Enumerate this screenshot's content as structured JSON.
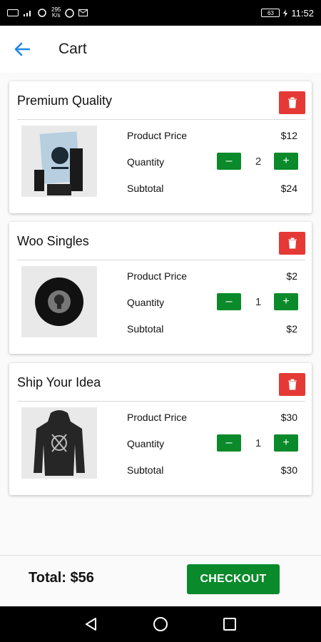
{
  "status_bar": {
    "speed_top": "295",
    "speed_bottom": "K/s",
    "battery": "63",
    "time": "11:52",
    "icons": [
      "volte-icon",
      "signal-icon",
      "wifi-icon",
      "whatsapp-icon",
      "gmail-icon",
      "vibrate-icon",
      "charging-icon"
    ]
  },
  "app_bar": {
    "title": "Cart",
    "back_icon": "arrow-left-icon"
  },
  "labels": {
    "price": "Product Price",
    "quantity": "Quantity",
    "subtotal": "Subtotal",
    "minus": "–",
    "plus": "+"
  },
  "cart_items": [
    {
      "name": "Premium Quality",
      "price": "$12",
      "quantity": "2",
      "subtotal": "$24",
      "image": "poster-photo"
    },
    {
      "name": "Woo Singles",
      "price": "$2",
      "quantity": "1",
      "subtotal": "$2",
      "image": "vinyl-record-photo"
    },
    {
      "name": "Ship Your Idea",
      "price": "$30",
      "quantity": "1",
      "subtotal": "$30",
      "image": "hoodie-photo"
    }
  ],
  "footer": {
    "total": "Total: $56",
    "checkout_label": "CHECKOUT"
  },
  "colors": {
    "accent": "#1e88e5",
    "delete": "#e53935",
    "green": "#0a8a2a"
  },
  "nav_bar": {
    "icons": [
      "back-triangle-icon",
      "home-circle-icon",
      "recents-square-icon"
    ]
  }
}
